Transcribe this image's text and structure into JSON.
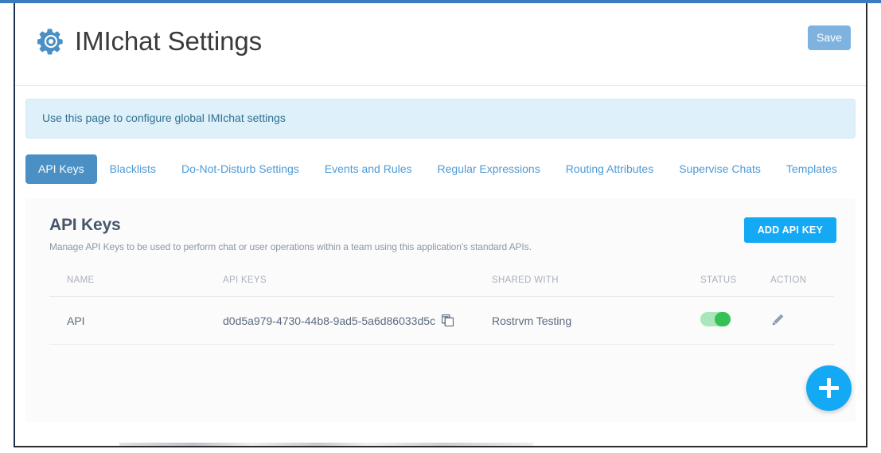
{
  "header": {
    "title": "IMIchat Settings",
    "gear_icon": "gear-icon",
    "save_label": "Save"
  },
  "banner": {
    "text": "Use this page to configure global IMIchat settings"
  },
  "tabs": [
    {
      "label": "API Keys",
      "active": true
    },
    {
      "label": "Blacklists",
      "active": false
    },
    {
      "label": "Do-Not-Disturb Settings",
      "active": false
    },
    {
      "label": "Events and Rules",
      "active": false
    },
    {
      "label": "Regular Expressions",
      "active": false
    },
    {
      "label": "Routing Attributes",
      "active": false
    },
    {
      "label": "Supervise Chats",
      "active": false
    },
    {
      "label": "Templates",
      "active": false
    }
  ],
  "card": {
    "title": "API Keys",
    "description": "Manage API Keys to be used to perform chat or user operations within a team using this application's standard APIs.",
    "add_button_label": "ADD API KEY"
  },
  "table": {
    "columns": [
      "NAME",
      "API KEYS",
      "SHARED WITH",
      "STATUS",
      "ACTION"
    ],
    "rows": [
      {
        "name": "API",
        "api_key": "d0d5a979-4730-44b8-9ad5-5a6d86033d5c",
        "copy_icon": "copy-icon",
        "shared_with": "Rostrvm Testing",
        "status": "on",
        "action_icon": "pencil-icon"
      }
    ]
  },
  "fab": {
    "icon": "plus-icon"
  },
  "colors": {
    "accent_blue": "#13a9f5",
    "tab_active_blue": "#4a90c4",
    "tab_link_blue": "#4e9ad6",
    "save_blue": "#7eb3df",
    "banner_bg": "#def0fa",
    "banner_text": "#31708f",
    "toggle_on": "#36c157",
    "toggle_track": "#a9e6b9",
    "title_text": "#3a3a3a",
    "card_title": "#46566b"
  }
}
